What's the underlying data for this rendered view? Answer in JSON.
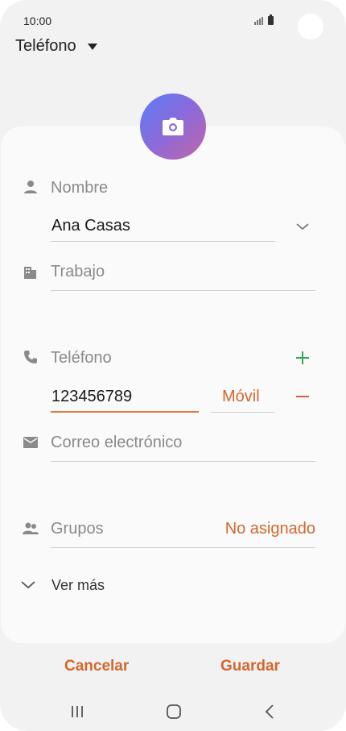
{
  "status": {
    "time": "10:00"
  },
  "header": {
    "storage_label": "Teléfono"
  },
  "form": {
    "name_label": "Nombre",
    "name_value": "Ana Casas",
    "work_placeholder": "Trabajo",
    "phone_label": "Teléfono",
    "phone_value": "123456789",
    "phone_type": "Móvil",
    "email_placeholder": "Correo electrónico",
    "groups_label": "Grupos",
    "groups_value": "No asignado",
    "more_label": "Ver más"
  },
  "footer": {
    "cancel_label": "Cancelar",
    "save_label": "Guardar"
  },
  "colors": {
    "accent": "#d4672e",
    "add": "#2fa84f",
    "remove": "#e0583e"
  }
}
